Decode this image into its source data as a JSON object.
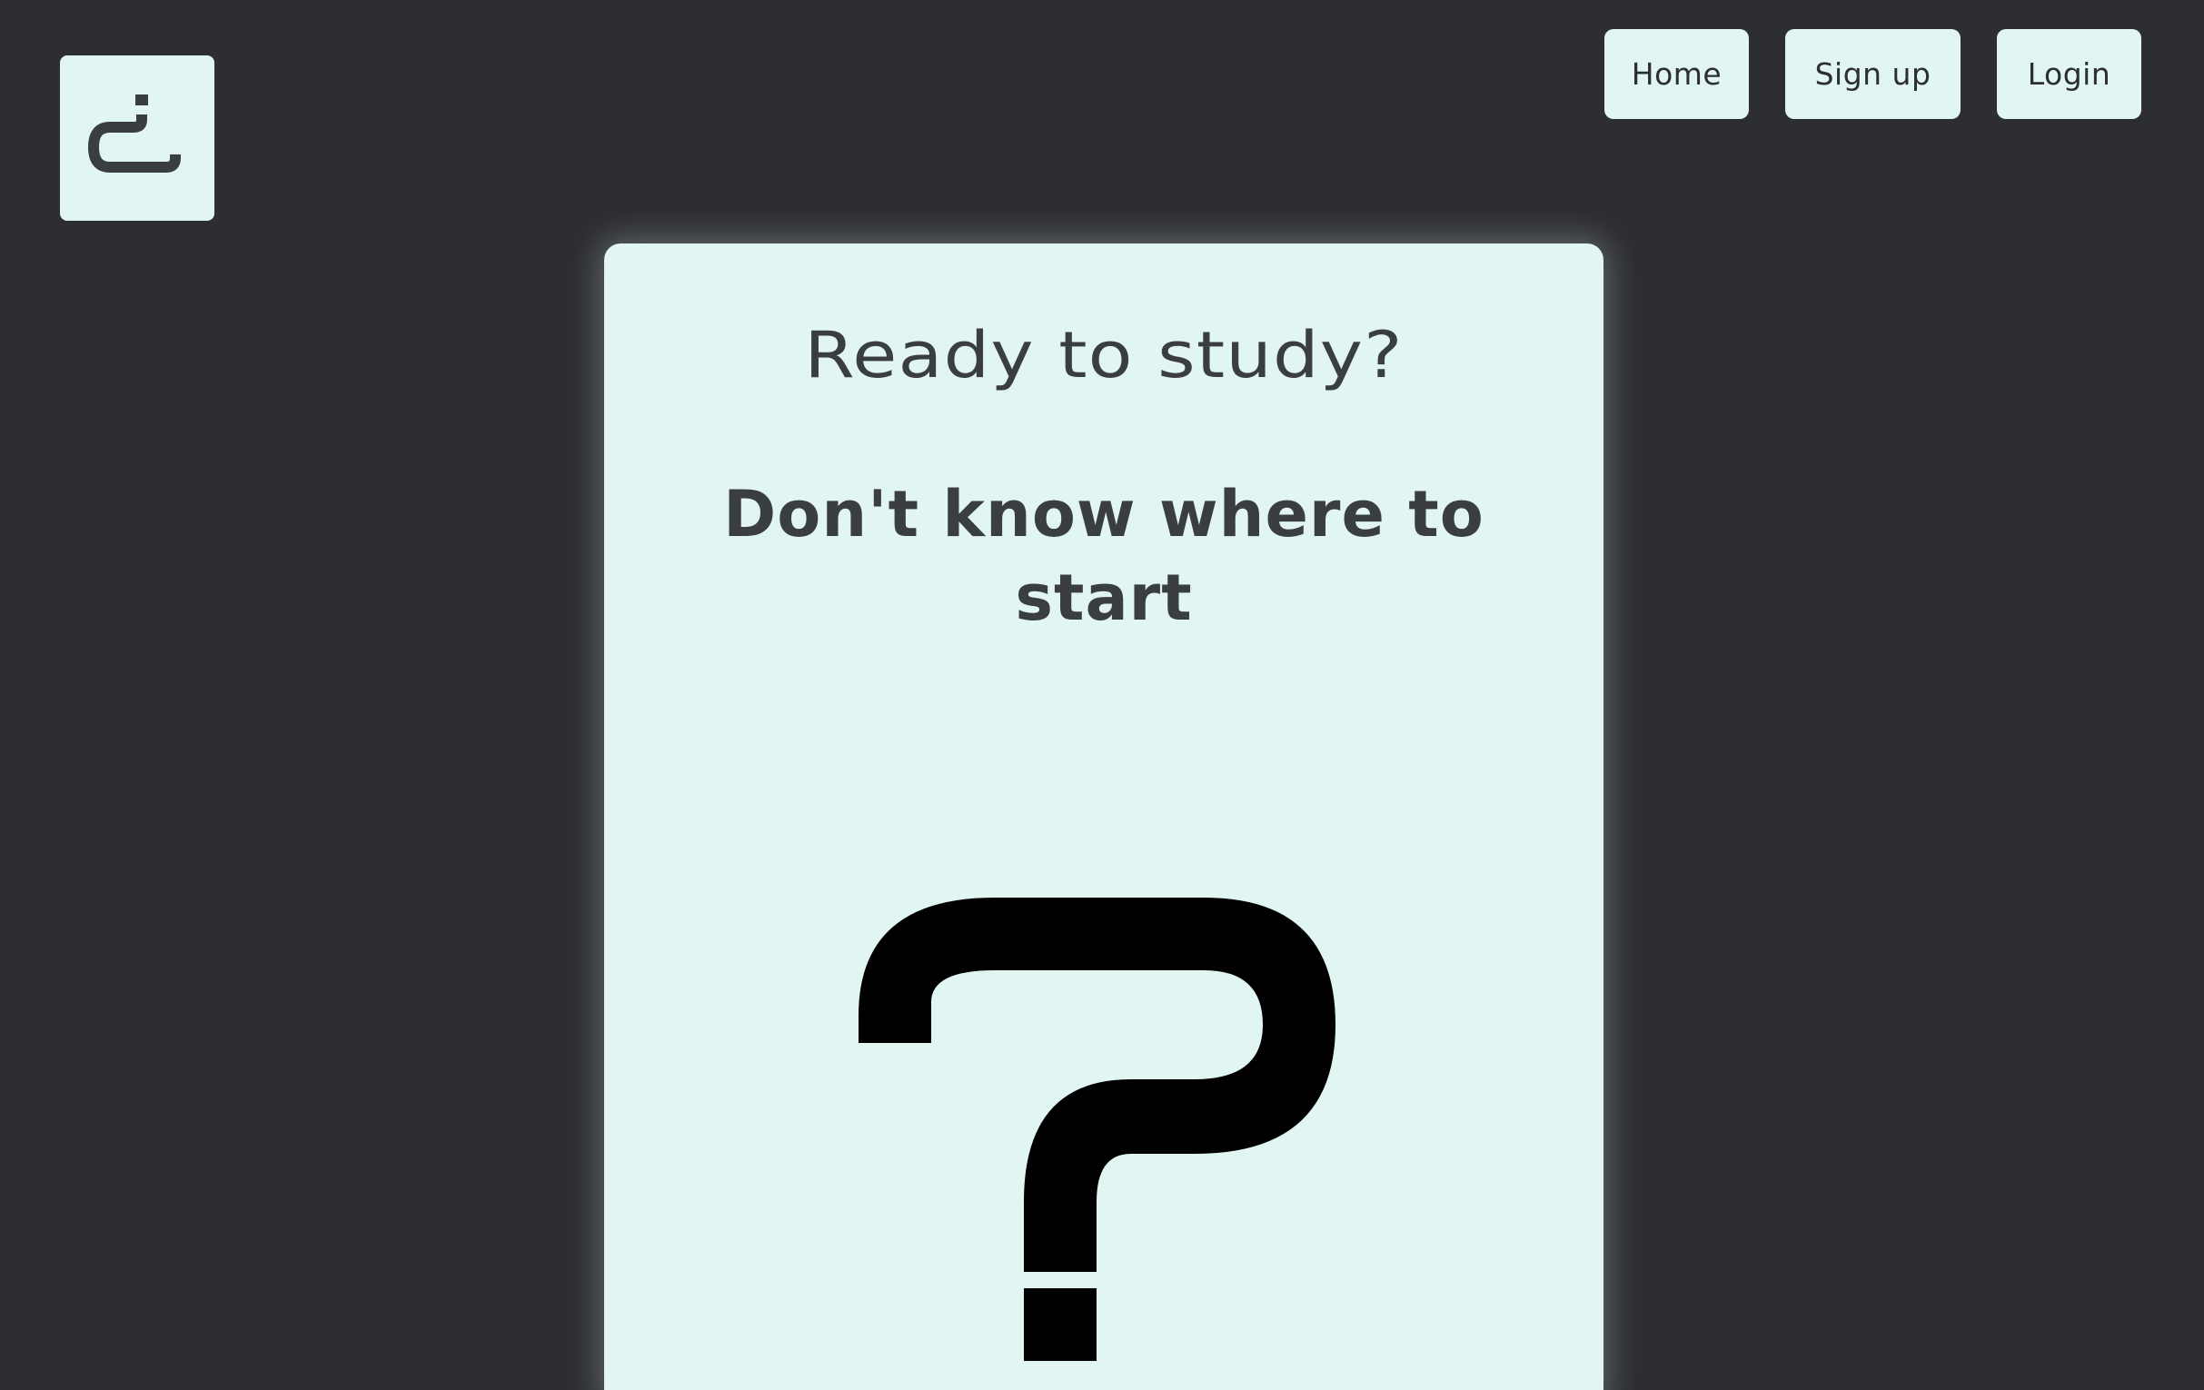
{
  "brand": {
    "logo_icon": "hook-logo-icon"
  },
  "nav": {
    "home_label": "Home",
    "signup_label": "Sign up",
    "login_label": "Login"
  },
  "card": {
    "title": "Ready to study?",
    "subtitle": "Don't know where to start",
    "illustration_icon": "question-mark-icon"
  },
  "colors": {
    "background": "#2d2e32",
    "surface": "#e1f5f2",
    "text": "#3a3d42",
    "illustration": "#000000"
  }
}
